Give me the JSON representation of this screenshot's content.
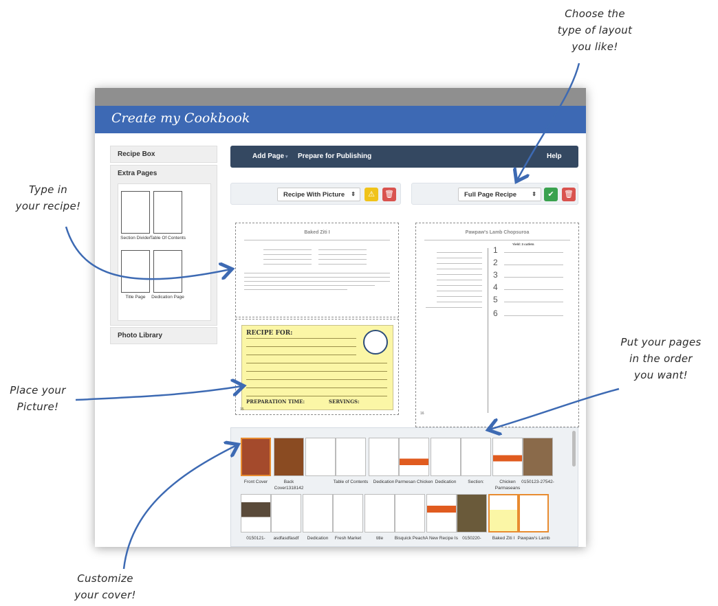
{
  "annotations": {
    "choose_layout": "Choose the\ntype of layout\nyou like!",
    "type_recipe": "Type in\nyour recipe!",
    "place_picture": "Place your\nPicture!",
    "order_pages": "Put your pages\nin the order\nyou want!",
    "customize_cover": "Customize\nyour cover!"
  },
  "app": {
    "title": "Create my Cookbook",
    "sidebar": {
      "recipe_box": "Recipe Box",
      "extra_pages": "Extra Pages",
      "photo_library": "Photo Library",
      "templates": [
        "Section Divider",
        "Table Of Contents",
        "Title Page",
        "Dedication Page"
      ]
    },
    "nav": {
      "add_page": "Add Page",
      "prepare": "Prepare for Publishing",
      "help": "Help"
    },
    "left_layout": "Recipe With Picture",
    "right_layout": "Full Page Recipe",
    "left_page": {
      "title": "Baked Ziti I",
      "page_number": "15"
    },
    "right_page": {
      "title": "Pawpaw's Lamb Chopsuroa",
      "yield": "Yield: 3 cutlets",
      "page_number": "16"
    },
    "card": {
      "heading": "RECIPE FOR:",
      "prep": "PREPARATION TIME:",
      "servings": "SERVINGS:"
    }
  },
  "strip": {
    "row1": [
      "Front Cover",
      "Back Cover1318142",
      "Table of Contents",
      "Dedication",
      "Parmesan Chicken",
      "Dedication",
      "Section:",
      "Chicken Parmaseans",
      "0150123-27542-"
    ],
    "row2": [
      "0150121-",
      "asdfasdfasdf",
      "Dedication",
      "Fresh Market",
      "title",
      "Bisquick Peach",
      "A New Recipe Is",
      "0150220-",
      "Baked Ziti I",
      "Pawpaw's Lamb"
    ]
  },
  "colors": {
    "titlebar": "#3d69b4",
    "navbar": "#344861",
    "warning": "#f0c31a",
    "danger": "#d9534f",
    "success": "#3aa24f",
    "selected": "#e88b2f"
  }
}
